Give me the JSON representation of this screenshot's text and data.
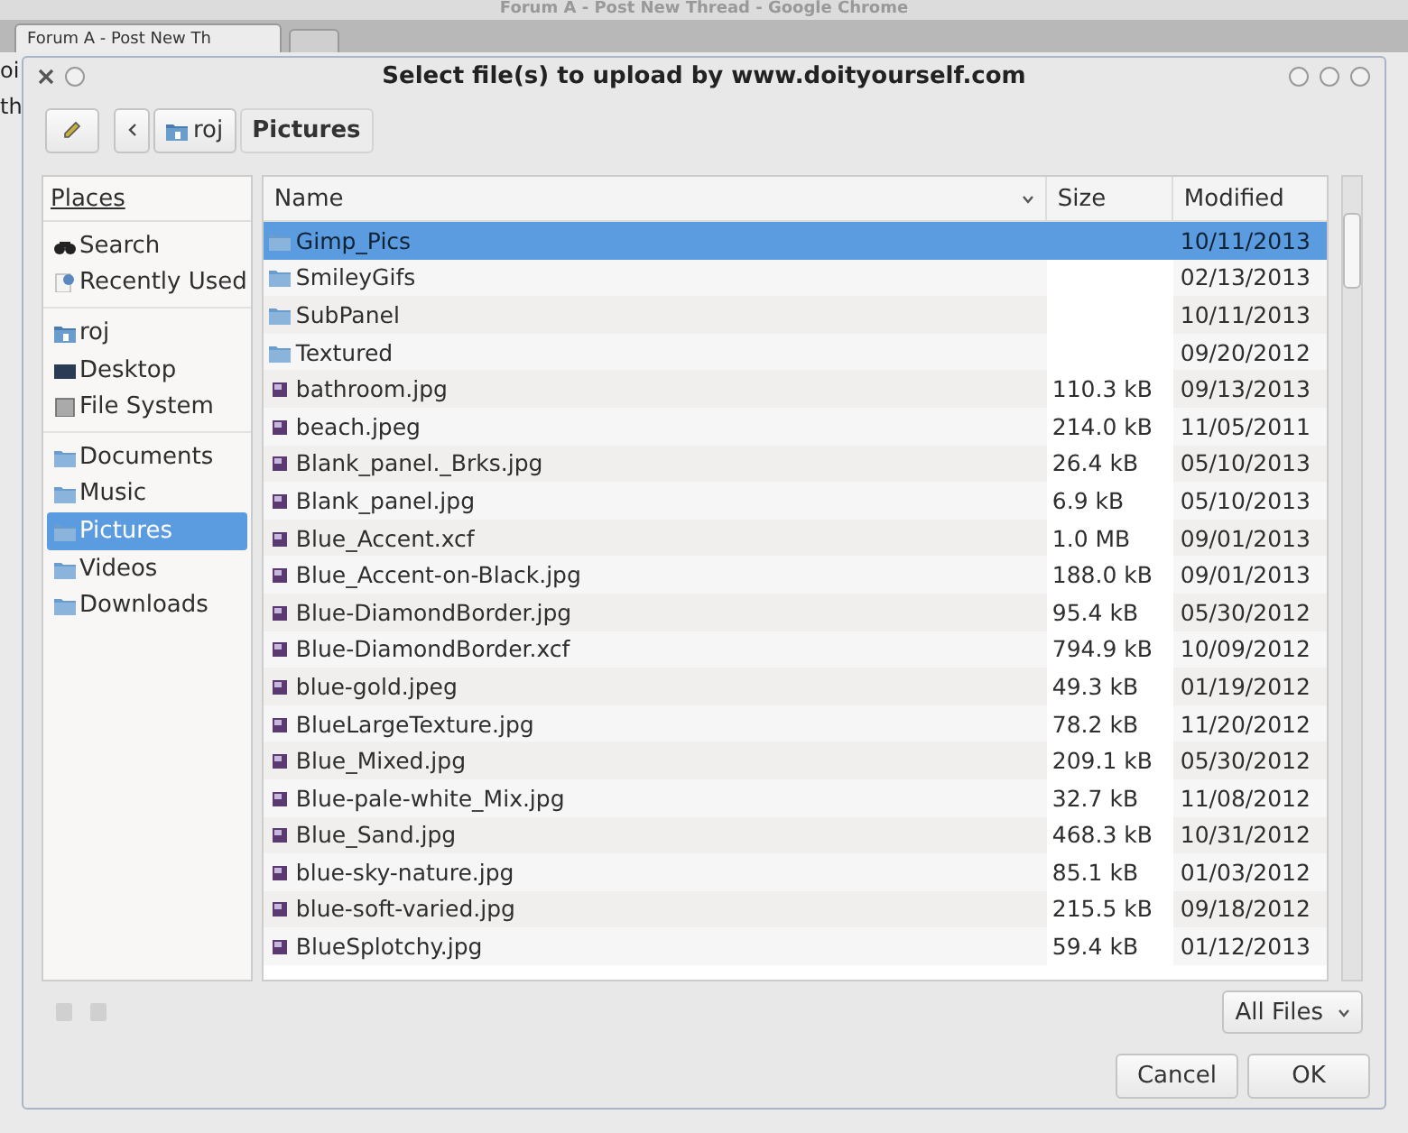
{
  "browser": {
    "title": "Forum A - Post New Thread - Google Chrome",
    "tab": "Forum A - Post New Th",
    "page_fragments": [
      "oi",
      "th"
    ]
  },
  "dialog": {
    "title": "Select file(s) to upload by www.doityourself.com",
    "path": [
      {
        "label": "roj",
        "kind": "home",
        "selected": false
      },
      {
        "label": "Pictures",
        "kind": "plain",
        "selected": true
      }
    ],
    "places": {
      "heading": "Places",
      "groups": [
        [
          {
            "label": "Search",
            "kind": "search",
            "selected": false
          },
          {
            "label": "Recently Used",
            "kind": "recent",
            "selected": false
          }
        ],
        [
          {
            "label": "roj",
            "kind": "home",
            "selected": false
          },
          {
            "label": "Desktop",
            "kind": "desktop",
            "selected": false
          },
          {
            "label": "File System",
            "kind": "drive",
            "selected": false
          }
        ],
        [
          {
            "label": "Documents",
            "kind": "folder",
            "selected": false
          },
          {
            "label": "Music",
            "kind": "folder",
            "selected": false
          },
          {
            "label": "Pictures",
            "kind": "folder",
            "selected": true
          },
          {
            "label": "Videos",
            "kind": "folder",
            "selected": false
          },
          {
            "label": "Downloads",
            "kind": "folder",
            "selected": false
          }
        ]
      ]
    },
    "columns": [
      "Name",
      "Size",
      "Modified"
    ],
    "files": [
      {
        "name": "Gimp_Pics",
        "kind": "folder",
        "modified": "10/11/2013",
        "selected": true
      },
      {
        "name": "SmileyGifs",
        "kind": "folder",
        "modified": "02/13/2013",
        "selected": false
      },
      {
        "name": "SubPanel",
        "kind": "folder",
        "modified": "10/11/2013",
        "selected": false
      },
      {
        "name": "Textured",
        "kind": "folder",
        "modified": "09/20/2012",
        "selected": false
      },
      {
        "name": "bathroom.jpg",
        "kind": "image",
        "size": "110.3 kB",
        "modified": "09/13/2013",
        "selected": false
      },
      {
        "name": "beach.jpeg",
        "kind": "image",
        "size": "214.0 kB",
        "modified": "11/05/2011",
        "selected": false
      },
      {
        "name": "Blank_panel._Brks.jpg",
        "kind": "image",
        "size": "26.4 kB",
        "modified": "05/10/2013",
        "selected": false
      },
      {
        "name": "Blank_panel.jpg",
        "kind": "image",
        "size": "6.9 kB",
        "modified": "05/10/2013",
        "selected": false
      },
      {
        "name": "Blue_Accent.xcf",
        "kind": "image",
        "size": "1.0 MB",
        "modified": "09/01/2013",
        "selected": false
      },
      {
        "name": "Blue_Accent-on-Black.jpg",
        "kind": "image",
        "size": "188.0 kB",
        "modified": "09/01/2013",
        "selected": false
      },
      {
        "name": "Blue-DiamondBorder.jpg",
        "kind": "image",
        "size": "95.4 kB",
        "modified": "05/30/2012",
        "selected": false
      },
      {
        "name": "Blue-DiamondBorder.xcf",
        "kind": "image",
        "size": "794.9 kB",
        "modified": "10/09/2012",
        "selected": false
      },
      {
        "name": "blue-gold.jpeg",
        "kind": "image",
        "size": "49.3 kB",
        "modified": "01/19/2012",
        "selected": false
      },
      {
        "name": "BlueLargeTexture.jpg",
        "kind": "image",
        "size": "78.2 kB",
        "modified": "11/20/2012",
        "selected": false
      },
      {
        "name": "Blue_Mixed.jpg",
        "kind": "image",
        "size": "209.1 kB",
        "modified": "05/30/2012",
        "selected": false
      },
      {
        "name": "Blue-pale-white_Mix.jpg",
        "kind": "image",
        "size": "32.7 kB",
        "modified": "11/08/2012",
        "selected": false
      },
      {
        "name": "Blue_Sand.jpg",
        "kind": "image",
        "size": "468.3 kB",
        "modified": "10/31/2012",
        "selected": false
      },
      {
        "name": "blue-sky-nature.jpg",
        "kind": "image",
        "size": "85.1 kB",
        "modified": "01/03/2012",
        "selected": false
      },
      {
        "name": "blue-soft-varied.jpg",
        "kind": "image",
        "size": "215.5 kB",
        "modified": "09/18/2012",
        "selected": false
      },
      {
        "name": "BlueSplotchy.jpg",
        "kind": "image",
        "size": "59.4 kB",
        "modified": "01/12/2013",
        "selected": false
      }
    ],
    "filter": "All Files",
    "buttons": [
      "Cancel",
      "OK"
    ]
  }
}
